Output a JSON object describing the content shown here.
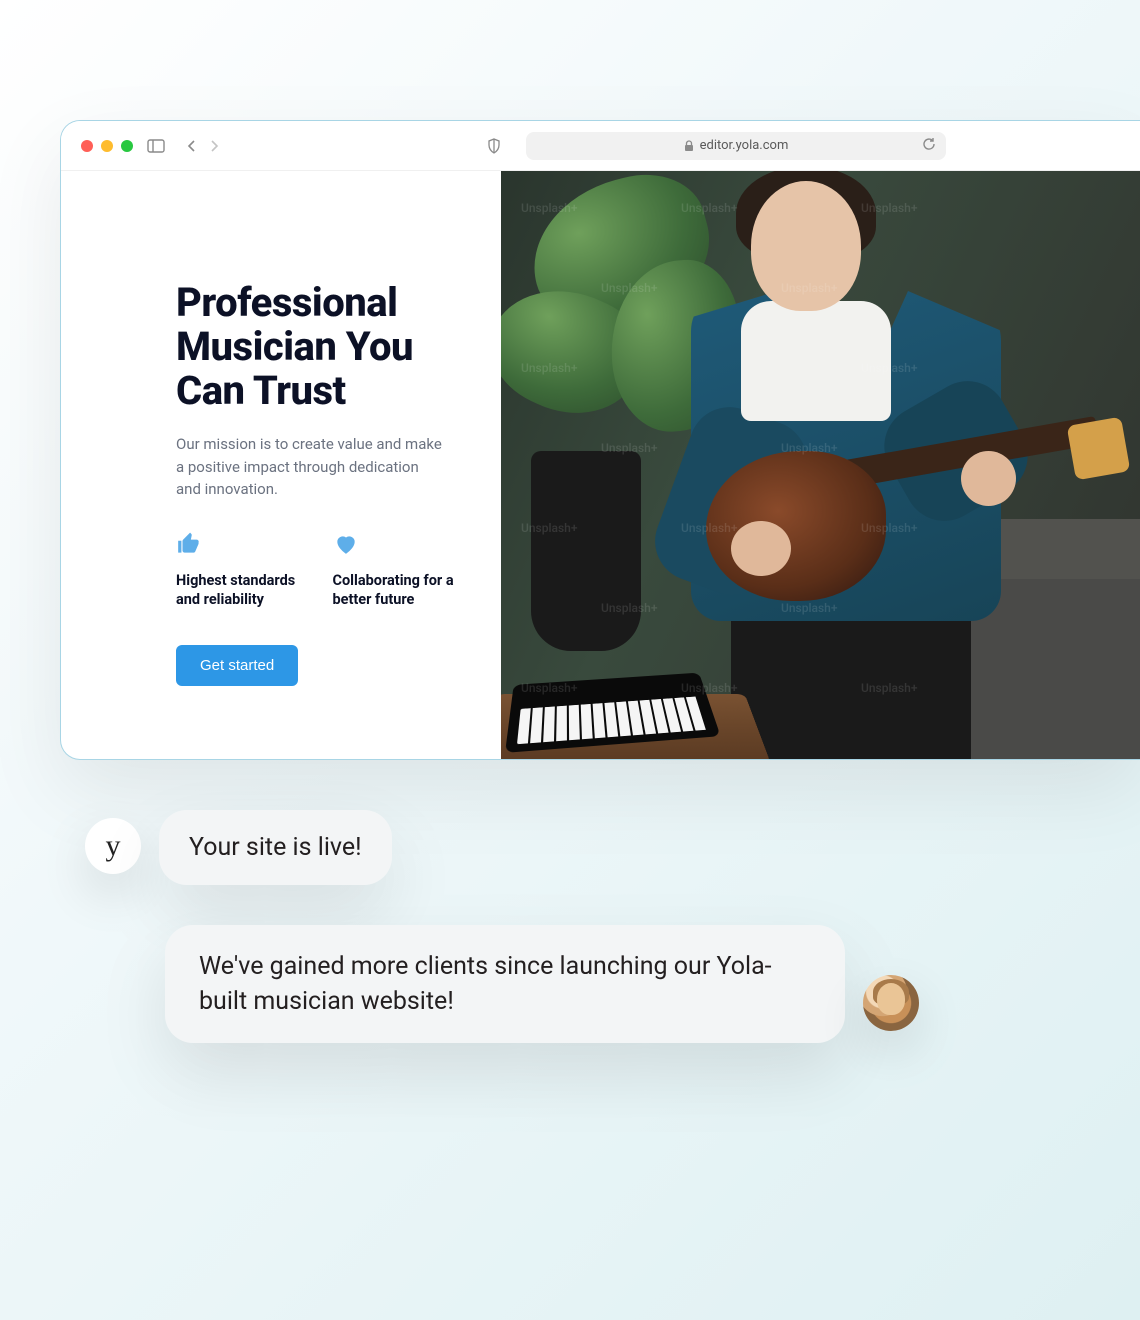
{
  "browser": {
    "url": "editor.yola.com",
    "lock_icon": "lock"
  },
  "hero": {
    "title": "Professional Musician You Can Trust",
    "subtitle": "Our mission is to create value and make a positive impact through dedication and innovation.",
    "features": [
      {
        "icon": "thumbs-up",
        "text": "Highest standards and reliability"
      },
      {
        "icon": "heart",
        "text": "Collaborating for a better future"
      }
    ],
    "cta_label": "Get started"
  },
  "image_watermark": "Unsplash+",
  "chat": {
    "sender_avatar_letter": "y",
    "message1": "Your site is live!",
    "message2": "We've gained more clients since launching our Yola-built musician website!"
  },
  "colors": {
    "accent": "#2d97e6",
    "icon_accent": "#5eaee9"
  }
}
